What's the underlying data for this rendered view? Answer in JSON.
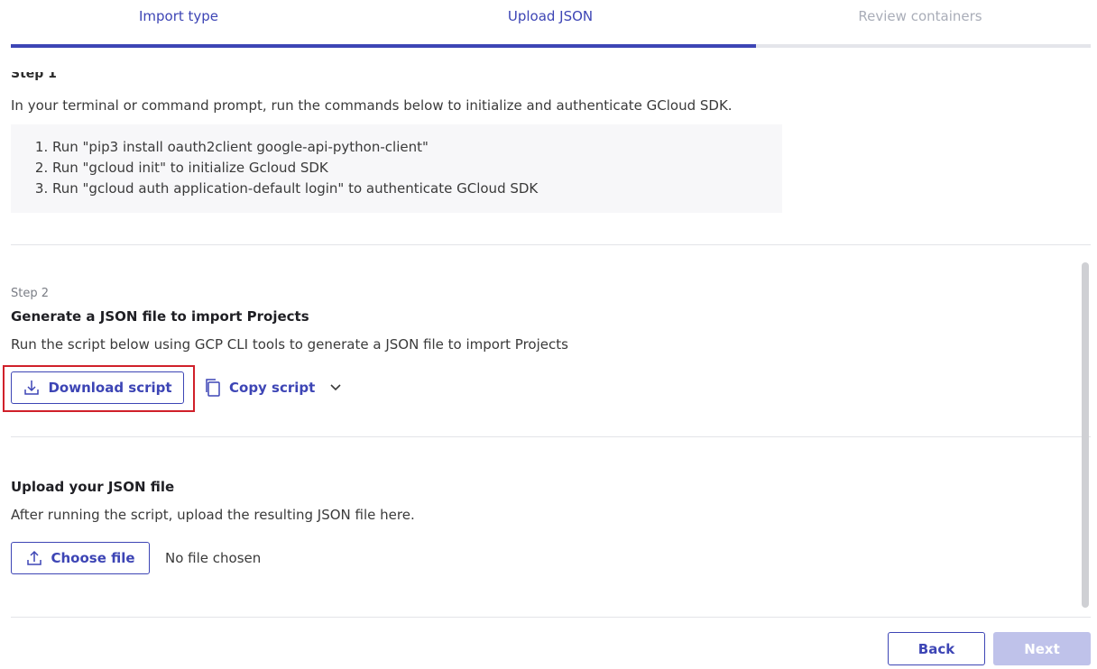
{
  "stepper": {
    "steps": [
      {
        "label": "Import type",
        "state": "completed"
      },
      {
        "label": "Upload JSON",
        "state": "active"
      },
      {
        "label": "Review containers",
        "state": "upcoming"
      }
    ],
    "progress_fraction": 0.69
  },
  "step1": {
    "heading_partial": "Step 1",
    "instruction": "In your terminal or command prompt, run the commands below to initialize and authenticate GCloud SDK.",
    "commands": [
      "Run \"pip3 install oauth2client google-api-python-client\"",
      "Run \"gcloud init\" to initialize Gcloud SDK",
      "Run \"gcloud auth application-default login\" to authenticate GCloud SDK"
    ]
  },
  "step2": {
    "label": "Step 2",
    "title": "Generate a JSON file to import Projects",
    "description": "Run the script below using GCP CLI tools to generate a JSON file to import Projects",
    "download_label": "Download script",
    "copy_label": "Copy script"
  },
  "upload": {
    "title": "Upload your JSON file",
    "description": "After running the script, upload the resulting JSON file here.",
    "choose_label": "Choose file",
    "file_status": "No file chosen"
  },
  "footer": {
    "back_label": "Back",
    "next_label": "Next"
  },
  "colors": {
    "accent": "#3d45b5",
    "highlight": "#d0202a",
    "disabled_button": "#bfc2ea"
  }
}
